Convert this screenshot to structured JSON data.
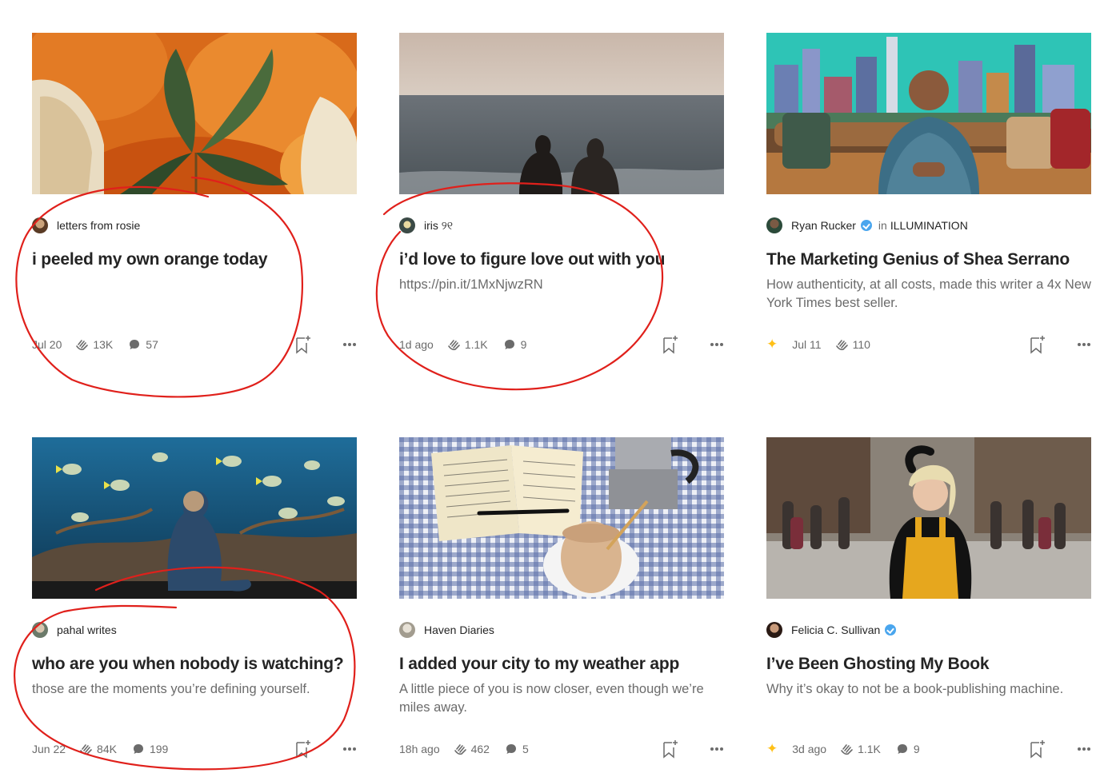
{
  "cards": [
    {
      "author": "letters from rosie",
      "publication": "",
      "title": "i peeled my own orange today",
      "subtitle": "",
      "date": "Jul 20",
      "claps": "13K",
      "responses": "57",
      "member_only": false,
      "verified": false,
      "image_desc": "orange-peel-photo"
    },
    {
      "author": "iris ୨୧",
      "publication": "",
      "title": "i’d love to figure love out with you",
      "subtitle": "https://pin.it/1MxNjwzRN",
      "date": "1d ago",
      "claps": "1.1K",
      "responses": "9",
      "member_only": false,
      "verified": false,
      "image_desc": "couple-at-sea-photo"
    },
    {
      "author": "Ryan Rucker",
      "publication_prefix": "in",
      "publication": "ILLUMINATION",
      "title": "The Marketing Genius of Shea Serrano",
      "subtitle": "How authenticity, at all costs, made this writer a 4x New York Times best seller.",
      "date": "Jul 11",
      "claps": "110",
      "responses": "",
      "member_only": true,
      "verified": true,
      "image_desc": "man-on-couch-city-photo"
    },
    {
      "author": "pahal writes",
      "publication": "",
      "title": "who are you when nobody is watching?",
      "subtitle": "those are the moments you’re defining yourself.",
      "date": "Jun 22",
      "claps": "84K",
      "responses": "199",
      "member_only": false,
      "verified": false,
      "image_desc": "child-at-aquarium-photo"
    },
    {
      "author": "Haven Diaries",
      "publication": "",
      "title": "I added your city to my weather app",
      "subtitle": "A little piece of you is now closer, even though we’re miles away.",
      "date": "18h ago",
      "claps": "462",
      "responses": "5",
      "member_only": false,
      "verified": false,
      "image_desc": "notebook-and-coffee-photo"
    },
    {
      "author": "Felicia C. Sullivan",
      "publication": "",
      "title": "I’ve Been Ghosting My Book",
      "subtitle": "Why it’s okay to not be a book-publishing machine.",
      "date": "3d ago",
      "claps": "1.1K",
      "responses": "9",
      "member_only": true,
      "verified": true,
      "image_desc": "woman-in-street-photo"
    }
  ],
  "colors": {
    "text": "#242424",
    "muted": "#6b6b6b",
    "star": "#ffc017",
    "verified": "#4aa6ee",
    "annotation": "#e0201b"
  },
  "icons": [
    "clap-icon",
    "response-icon",
    "bookmark-add-icon",
    "more-icon",
    "star-icon",
    "verified-icon"
  ]
}
